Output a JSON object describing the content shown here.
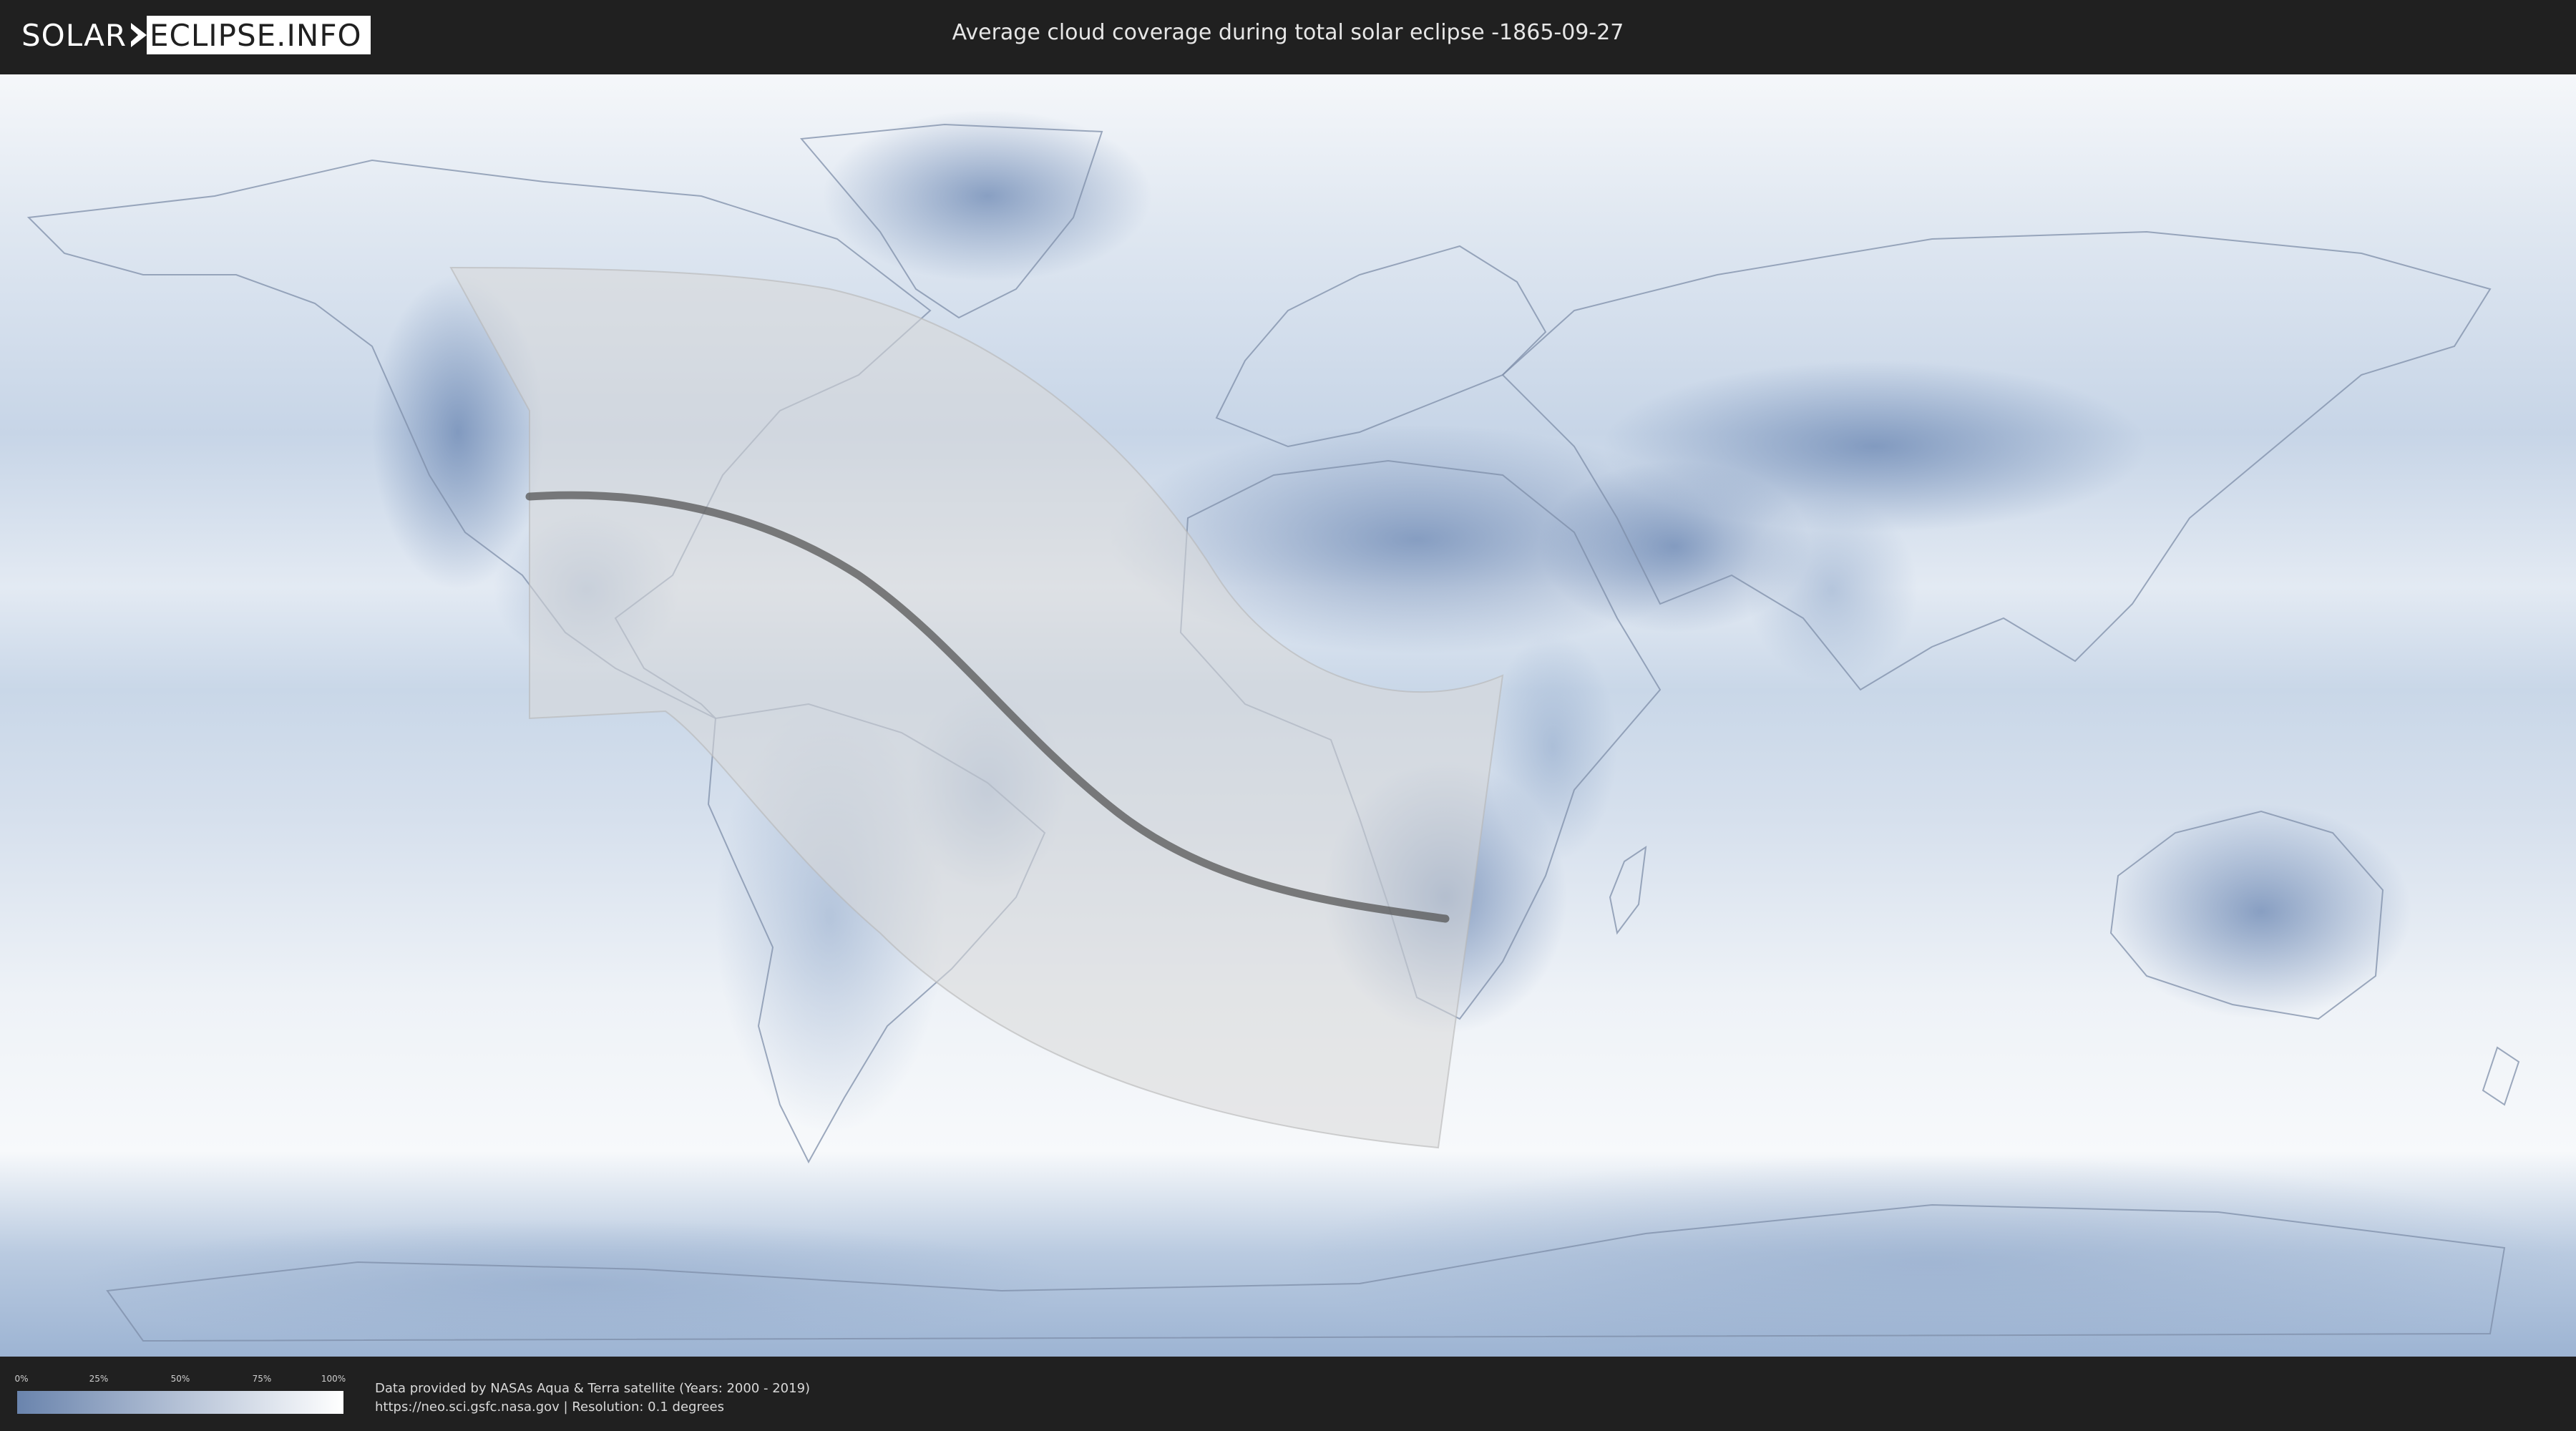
{
  "header": {
    "logo_part1": "SOLAR",
    "logo_part2": "ECLIPSE.INFO",
    "title": "Average cloud coverage during total solar eclipse -1865-09-27"
  },
  "legend": {
    "ticks": [
      "0%",
      "25%",
      "50%",
      "75%",
      "100%"
    ],
    "gradient_from": "#6a84ad",
    "gradient_to": "#ffffff"
  },
  "footer": {
    "line1": "Data provided by NASAs Aqua & Terra satellite (Years: 2000 - 2019)",
    "line2": "https://neo.sci.gsfc.nasa.gov | Resolution: 0.1 degrees"
  },
  "colors": {
    "background": "#202020",
    "clear_sky": "#5f7daa",
    "full_cloud": "#ffffff",
    "visibility_zone": "#dcdcdc",
    "totality_path": "#555555"
  }
}
